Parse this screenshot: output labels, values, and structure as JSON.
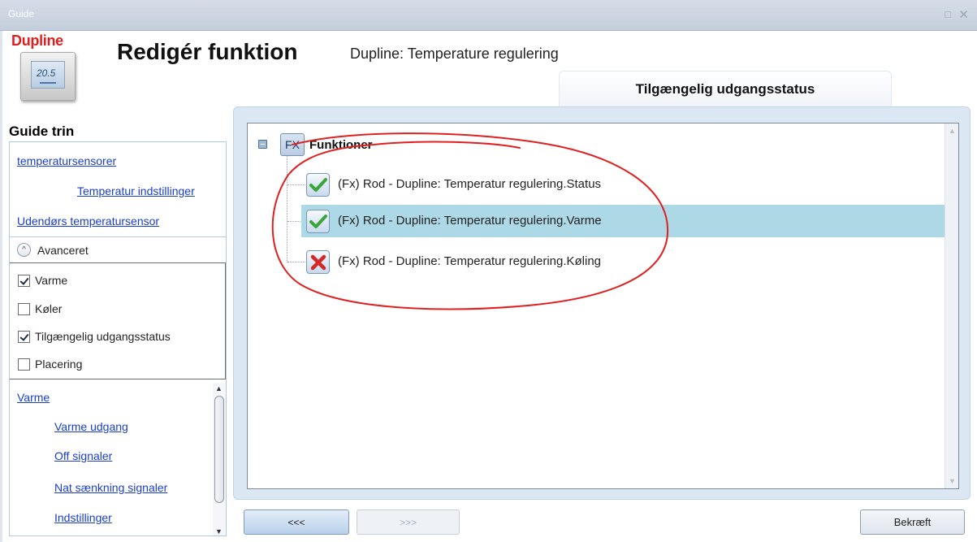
{
  "window": {
    "title": "Guide",
    "maximize_glyph": "□",
    "close_glyph": "✕"
  },
  "header": {
    "brand": "Dupline",
    "device_readout": "20.5",
    "title": "Redigér funktion",
    "subtitle": "Dupline: Temperature regulering"
  },
  "tab": {
    "label": "Tilgængelig udgangsstatus"
  },
  "steps": {
    "heading": "Guide trin",
    "links_top": [
      {
        "label": "temperatursensorer"
      },
      {
        "label": "Temperatur indstillinger"
      },
      {
        "label": "Udendørs temperatursensor"
      }
    ],
    "advanced": {
      "label": "Avanceret",
      "toggle_glyph": "^",
      "options": [
        {
          "label": "Varme",
          "checked": true
        },
        {
          "label": "Køler",
          "checked": false
        },
        {
          "label": "Tilgængelig udgangsstatus",
          "checked": true
        },
        {
          "label": "Placering",
          "checked": false
        }
      ]
    },
    "links_bottom": [
      {
        "label": "Varme"
      },
      {
        "label": "Varme udgang"
      },
      {
        "label": "Off signaler"
      },
      {
        "label": "Nat sænkning signaler"
      },
      {
        "label": "Indstillinger"
      }
    ],
    "scroll_up": "▲",
    "scroll_down": "▼"
  },
  "tree": {
    "root_badge": "FX",
    "root_label": "Funktioner",
    "items": [
      {
        "label": "(Fx) Rod - Dupline: Temperatur regulering.Status",
        "state": "ok",
        "selected": false
      },
      {
        "label": "(Fx) Rod - Dupline: Temperatur regulering.Varme",
        "state": "ok",
        "selected": true
      },
      {
        "label": "(Fx) Rod - Dupline: Temperatur regulering.Køling",
        "state": "error",
        "selected": false
      }
    ],
    "scroll_up": "▲",
    "scroll_down": "▼"
  },
  "buttons": {
    "prev": "<<<",
    "next": ">>>",
    "confirm": "Bekræft"
  },
  "colors": {
    "link": "#1a3ec8",
    "selected_row": "#add8e6",
    "annotation": "#e02020",
    "brand": "#e01e1e"
  }
}
